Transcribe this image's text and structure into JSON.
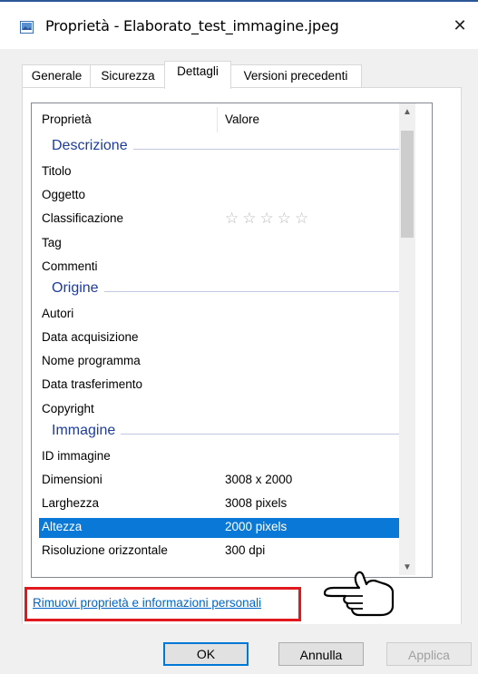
{
  "window": {
    "title": "Proprietà - Elaborato_test_immagine.jpeg",
    "close_glyph": "✕"
  },
  "tabs": [
    {
      "label": "Generale"
    },
    {
      "label": "Sicurezza"
    },
    {
      "label": "Dettagli",
      "active": true
    },
    {
      "label": "Versioni precedenti"
    }
  ],
  "list": {
    "col_property": "Proprietà",
    "col_value": "Valore",
    "rating_stars": "★★★★★",
    "rows": [
      {
        "type": "group",
        "label": "Descrizione"
      },
      {
        "type": "row",
        "key": "Titolo",
        "value": ""
      },
      {
        "type": "row",
        "key": "Oggetto",
        "value": ""
      },
      {
        "type": "row",
        "key": "Classificazione",
        "value": "☆☆☆☆☆"
      },
      {
        "type": "row",
        "key": "Tag",
        "value": ""
      },
      {
        "type": "row",
        "key": "Commenti",
        "value": ""
      },
      {
        "type": "group",
        "label": "Origine"
      },
      {
        "type": "row",
        "key": "Autori",
        "value": ""
      },
      {
        "type": "row",
        "key": "Data acquisizione",
        "value": ""
      },
      {
        "type": "row",
        "key": "Nome programma",
        "value": ""
      },
      {
        "type": "row",
        "key": "Data trasferimento",
        "value": ""
      },
      {
        "type": "row",
        "key": "Copyright",
        "value": ""
      },
      {
        "type": "group",
        "label": "Immagine"
      },
      {
        "type": "row",
        "key": "ID immagine",
        "value": ""
      },
      {
        "type": "row",
        "key": "Dimensioni",
        "value": "3008 x 2000"
      },
      {
        "type": "row",
        "key": "Larghezza",
        "value": "3008 pixels"
      },
      {
        "type": "row",
        "key": "Altezza",
        "value": "2000 pixels",
        "selected": true
      },
      {
        "type": "row",
        "key": "Risoluzione orizzontale",
        "value": "300 dpi"
      }
    ]
  },
  "link": {
    "label": "Rimuovi proprietà e informazioni personali"
  },
  "buttons": {
    "ok": "OK",
    "cancel": "Annulla",
    "apply": "Applica"
  },
  "colors": {
    "accent": "#0078d7",
    "selection": "#0a78d7",
    "group_header": "#1e3c9c",
    "highlight_border": "#e0191f",
    "link": "#0064c8"
  }
}
